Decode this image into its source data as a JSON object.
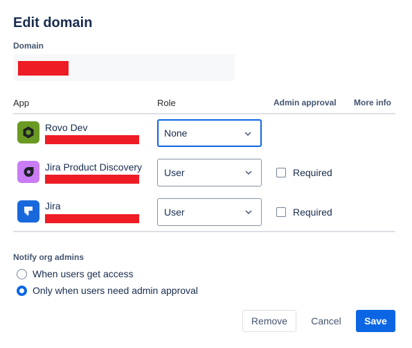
{
  "dialog": {
    "title": "Edit domain"
  },
  "domain": {
    "label": "Domain"
  },
  "table": {
    "headers": {
      "app": "App",
      "role": "Role",
      "admin_approval": "Admin approval",
      "more_info": "More info"
    },
    "rows": [
      {
        "app": "Rovo Dev",
        "role": "None",
        "icon": "rovo-dev-icon",
        "icon_color": "#6a9a23"
      },
      {
        "app": "Jira Product Discovery",
        "role": "User",
        "icon": "jira-product-discovery-icon",
        "icon_color": "#c97cf4",
        "approval_label": "Required"
      },
      {
        "app": "Jira",
        "role": "User",
        "icon": "jira-icon",
        "icon_color": "#1868db",
        "approval_label": "Required"
      }
    ]
  },
  "notify": {
    "label": "Notify org admins",
    "options": [
      {
        "label": "When users get access",
        "checked": false
      },
      {
        "label": "Only when users need admin approval",
        "checked": true
      }
    ]
  },
  "buttons": {
    "remove": "Remove",
    "cancel": "Cancel",
    "save": "Save"
  },
  "colors": {
    "primary": "#0c66e4",
    "redaction": "#ee1c25"
  }
}
